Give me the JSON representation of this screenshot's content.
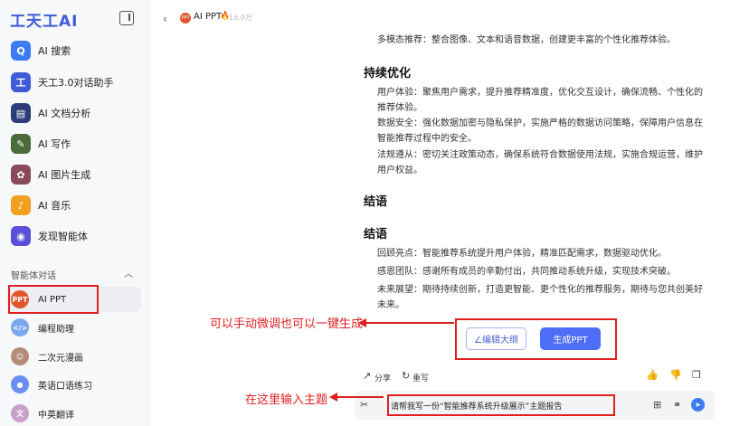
{
  "app": {
    "logo": "工天工AI"
  },
  "sidebar": {
    "items": [
      {
        "label": "AI 搜索",
        "icon": "search-icon",
        "color": "#3d7bf5",
        "glyph": "Q"
      },
      {
        "label": "天工3.0对话助手",
        "icon": "chat-icon",
        "color": "#3f5bd8",
        "glyph": "工"
      },
      {
        "label": "AI 文档分析",
        "icon": "document-icon",
        "color": "#2c3e7a",
        "glyph": "▤"
      },
      {
        "label": "AI 写作",
        "icon": "writing-icon",
        "color": "#4a6b3a",
        "glyph": "✎"
      },
      {
        "label": "AI 图片生成",
        "icon": "image-icon",
        "color": "#8b4a5c",
        "glyph": "✿"
      },
      {
        "label": "AI 音乐",
        "icon": "music-icon",
        "color": "#f0a020",
        "glyph": "♪"
      },
      {
        "label": "发现智能体",
        "icon": "robot-icon",
        "color": "#5a4fd8",
        "glyph": "◉"
      }
    ],
    "section_title": "智能体对话",
    "agents": [
      {
        "label": "AI PPT",
        "icon": "ppt-icon",
        "color": "#e2562e",
        "glyph": "PPT"
      },
      {
        "label": "编程助理",
        "icon": "code-icon",
        "color": "#7aa7f0",
        "glyph": "</>"
      },
      {
        "label": "二次元漫画",
        "icon": "anime-icon",
        "color": "#b48c78",
        "glyph": "☺"
      },
      {
        "label": "英语口语练习",
        "icon": "english-icon",
        "color": "#6a8ff0",
        "glyph": "●"
      },
      {
        "label": "中英翻译",
        "icon": "translate-icon",
        "color": "#c8a2c8",
        "glyph": "文"
      }
    ]
  },
  "header": {
    "title": "AI PPT",
    "count": "16.0万",
    "hot": "🔥"
  },
  "content": {
    "top_cut": "多模态推荐：整合图像、文本和语音数据，创建更丰富的个性化推荐体验。",
    "section1_title": "持续优化",
    "s1_p1": "用户体验：聚焦用户需求，提升推荐精准度，优化交互设计，确保流畅、个性化的推荐体验。",
    "s1_p2": "数据安全：强化数据加密与隐私保护，实施严格的数据访问策略，保障用户信息在智能推荐过程中的安全。",
    "s1_p3": "法规遵从：密切关注政策动态，确保系统符合数据使用法规，实施合规运营，维护用户权益。",
    "section2_title": "结语",
    "section3_title": "结语",
    "s3_p1": "回顾亮点：智能推荐系统提升用户体验，精准匹配需求，数据驱动优化。",
    "s3_p2": "感恩团队：感谢所有成员的辛勤付出，共同推动系统升级，实现技术突破。",
    "s3_p3": "未来展望：期待持续创新，打造更智能、更个性化的推荐服务，期待与您共创美好未来。"
  },
  "buttons": {
    "edit_outline": "∠编辑大纲",
    "generate_ppt": "生成PPT"
  },
  "actions": {
    "share": "分享",
    "rewrite": "重写"
  },
  "annotations": {
    "note1": "可以手动微调也可以一键生成",
    "note2": "在这里输入主题"
  },
  "input": {
    "value": "请帮我写一份“智能推荐系统升级展示”主题报告"
  },
  "colors": {
    "accent": "#4f6ef7",
    "annotation": "#e02020",
    "logo": "#3f5bd8"
  }
}
